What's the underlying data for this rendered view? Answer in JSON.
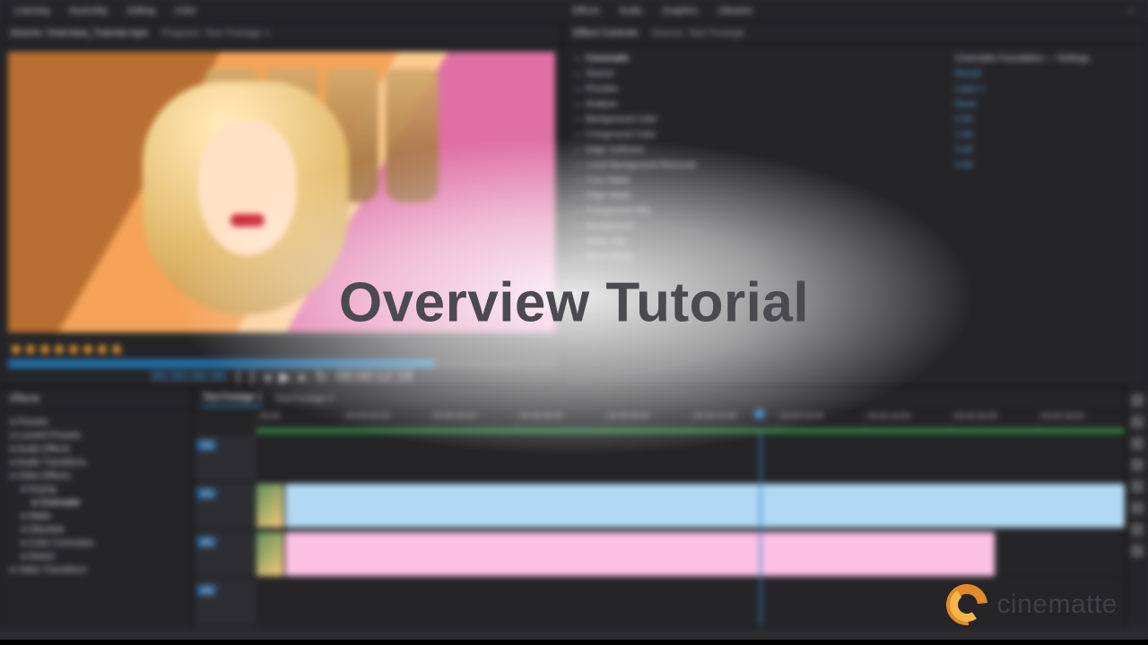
{
  "overlay": {
    "title": "Overview Tutorial",
    "brand_name": "cinematte"
  },
  "menubar": {
    "items": [
      "Learning",
      "Assembly",
      "Editing",
      "Color",
      "Effects",
      "Audio",
      "Graphics",
      "Libraries"
    ]
  },
  "source_panel": {
    "title": "Source: Overview_Tutorial.mp4",
    "sequence_label": "Program: Test Footage 1"
  },
  "effect_panel": {
    "title": "Effect Controls",
    "source_label": "Source: Test Footage",
    "group": "Cinematte",
    "params": [
      "Source",
      "Preview",
      "Analyze",
      "Background Color",
      "Foreground Color",
      "Edge Softness",
      "Local Background Removal",
      "Core Matte",
      "Edge Matte",
      "Foreground HSL",
      "Background",
      "Matte Clip",
      "Blend Mode"
    ],
    "value_header": "Cinematte Foundation — Settings",
    "values": [
      "Result",
      "Layer 1",
      "None",
      "0.50",
      "1.00",
      "0.00",
      "0.00"
    ]
  },
  "transport": {
    "timecode_left": "00:00:00:00",
    "timecode_right": "00:00:12:18"
  },
  "bins": {
    "title": "Effects",
    "items": [
      "Presets",
      "Lumetri Presets",
      "Audio Effects",
      "Audio Transitions",
      "Video Effects",
      "Keying",
      "Cinematte",
      "Matte",
      "Obsolete",
      "Color Correction",
      "Distort",
      "Video Transitions"
    ]
  },
  "timeline": {
    "tab_active": "Test Footage 1",
    "tab_other": "Test Footage 2",
    "ruler": [
      "00:00",
      "00:00:02:00",
      "00:00:04:00",
      "00:00:06:00",
      "00:00:08:00",
      "00:00:10:00",
      "00:00:12:00",
      "00:00:14:00",
      "00:00:16:00",
      "00:00:18:00"
    ],
    "tracks": {
      "v2": "V2",
      "v1": "V1",
      "a1": "A1",
      "a2": "A2"
    }
  },
  "colors": {
    "accent_blue": "#2f7bbf",
    "clip_blue": "#a9cfe8",
    "clip_pink": "#f0b7d8",
    "brand_orange": "#e08a2a",
    "brand_yellow": "#f5b74a"
  }
}
